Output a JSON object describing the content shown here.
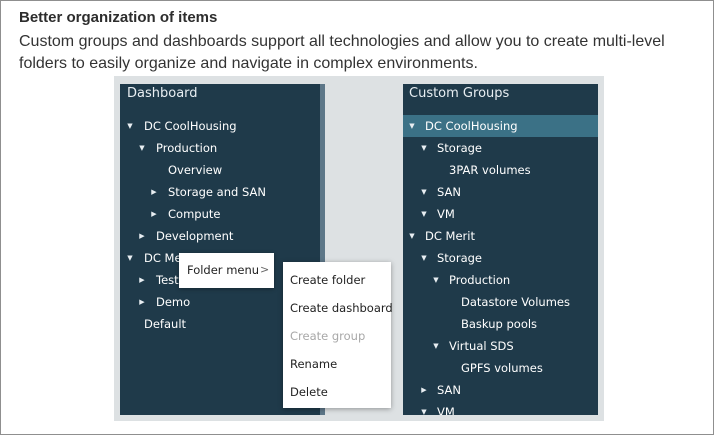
{
  "heading": "Better organization of items",
  "paragraph": "Custom groups and dashboards support all technologies and allow you to create multi-level folders to easily organize and navigate in complex environments.",
  "dashboard_panel": {
    "title": "Dashboard",
    "items": [
      {
        "label": "DC CoolHousing",
        "expanded": true
      },
      {
        "label": "Production",
        "expanded": true
      },
      {
        "label": "Overview"
      },
      {
        "label": "Storage and SAN",
        "expanded": false
      },
      {
        "label": "Compute",
        "expanded": false
      },
      {
        "label": "Development",
        "expanded": false
      },
      {
        "label": "DC Merit",
        "expanded": true
      },
      {
        "label": "Testi",
        "expanded": false
      },
      {
        "label": "Demo",
        "expanded": false
      },
      {
        "label": "Default"
      }
    ]
  },
  "groups_panel": {
    "title": "Custom Groups",
    "items": [
      {
        "label": "DC CoolHousing",
        "expanded": true,
        "selected": true
      },
      {
        "label": "Storage",
        "expanded": true
      },
      {
        "label": "3PAR volumes"
      },
      {
        "label": "SAN",
        "expanded": true
      },
      {
        "label": "VM",
        "expanded": true
      },
      {
        "label": "DC Merit",
        "expanded": true
      },
      {
        "label": "Storage",
        "expanded": true
      },
      {
        "label": "Production",
        "expanded": true
      },
      {
        "label": "Datastore Volumes"
      },
      {
        "label": "Baskup pools"
      },
      {
        "label": "Virtual SDS",
        "expanded": true
      },
      {
        "label": "GPFS volumes"
      },
      {
        "label": "SAN",
        "expanded": false
      },
      {
        "label": "VM",
        "expanded": true
      }
    ]
  },
  "folder_menu": {
    "label": "Folder menu",
    "chevron": ">"
  },
  "context_menu": {
    "items": [
      {
        "label": "Create folder",
        "enabled": true
      },
      {
        "label": "Create dashboard",
        "enabled": true
      },
      {
        "label": "Create group",
        "enabled": false
      },
      {
        "label": "Rename",
        "enabled": true
      },
      {
        "label": "Delete",
        "enabled": true
      }
    ]
  },
  "icons": {
    "expanded": "▼",
    "collapsed": "▶"
  },
  "colors": {
    "panel_bg": "#1f3a4a",
    "selected_row": "#3b7186",
    "disabled_text": "#a8a8a8"
  }
}
